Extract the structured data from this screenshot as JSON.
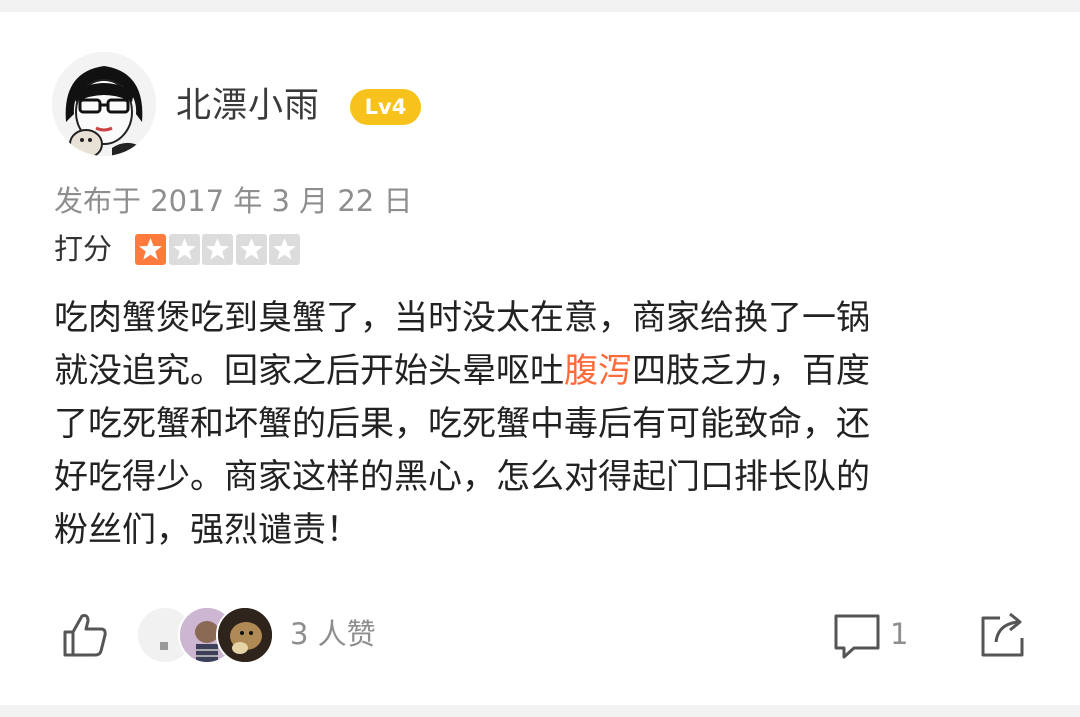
{
  "user": {
    "name": "北漂小雨",
    "level": "Lv4",
    "avatar_icon": "cartoon-avatar-with-glasses"
  },
  "review": {
    "publish_date": "发布于 2017 年 3 月 22 日",
    "rating_label": "打分",
    "rating": {
      "value": 1,
      "max": 5
    },
    "lines": [
      [
        "吃肉蟹煲吃到臭蟹了，当时没太在意，商家给换了一锅"
      ],
      [
        "就没追究。回家之后开始头晕呕吐",
        "腹泻",
        "四肢乏力，百度"
      ],
      [
        "了吃死蟹和坏蟹的后果，吃死蟹中毒后有可能致命，还"
      ],
      [
        "好吃得少。商家这样的黑心，怎么对得起门口排长队的"
      ],
      [
        "粉丝们，强烈谴责！"
      ]
    ],
    "highlight_color": "#ff6a3b"
  },
  "actions": {
    "likes_text": "3 人赞",
    "comments_count": "1",
    "like_icon": "thumbs-up-icon",
    "comment_icon": "comment-icon",
    "share_icon": "share-icon"
  },
  "colors": {
    "badge": "#f7c21c",
    "star_active": "#ff7a3d",
    "star_inactive": "#dcdcdc"
  }
}
